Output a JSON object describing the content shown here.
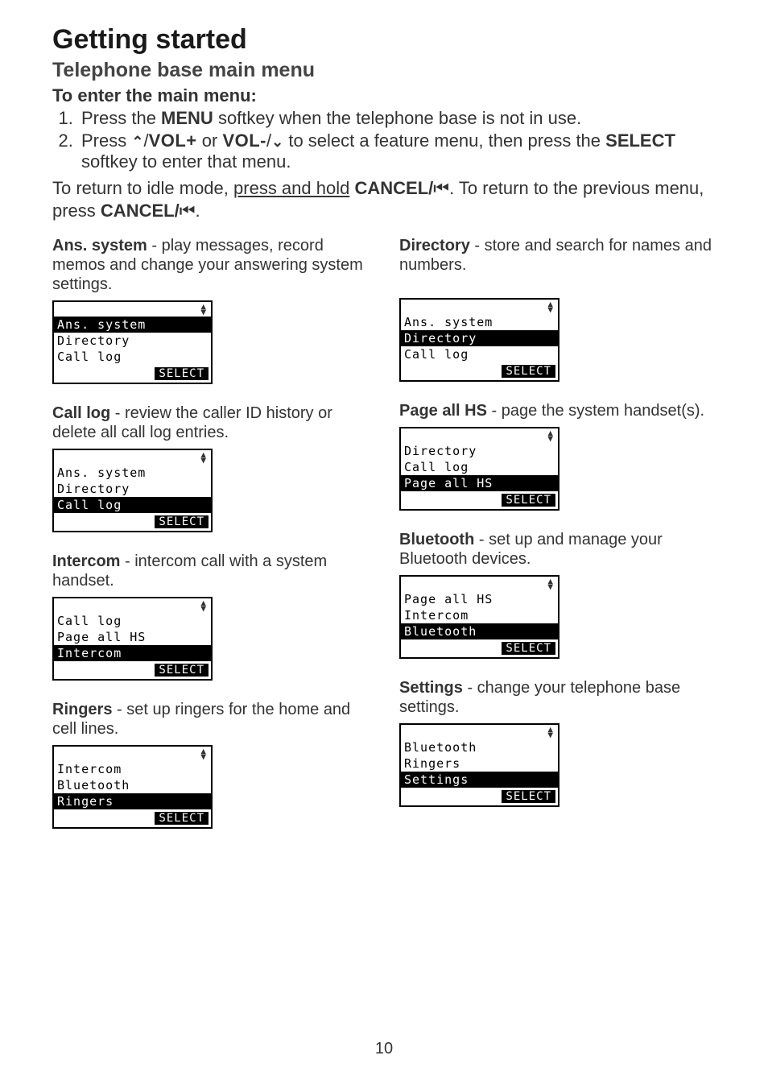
{
  "page": {
    "number": "10",
    "h1": "Getting started",
    "h2": "Telephone base main menu",
    "h3": "To enter the main menu:",
    "li1_a": "Press the ",
    "li1_b": "MENU",
    "li1_c": " softkey when the telephone base is not in use.",
    "li2_a": "Press ",
    "li2_up": "⌃",
    "li2_b": "/",
    "li2_volup": "VOL+",
    "li2_c": " or ",
    "li2_voldn": "VOL-",
    "li2_d": "/",
    "li2_dn": "⌄",
    "li2_e": " to select a feature menu, then press the ",
    "li2_sel": "SELECT",
    "li2_f": " softkey to enter that menu.",
    "ret_a": "To return to idle mode, ",
    "ret_b": "press and hold",
    "ret_c": " ",
    "ret_cancel": "CANCEL/",
    "ret_icon": "⏮",
    "ret_d": ". To return to the previous menu, press ",
    "ret_cancel2": "CANCEL/",
    "ret_icon2": "⏮",
    "ret_e": "."
  },
  "items": {
    "ans": {
      "title": "Ans. system",
      "desc": " - play messages, record memos and change your answering system settings."
    },
    "dir": {
      "title": "Directory",
      "desc": " - store and search for names and numbers."
    },
    "log": {
      "title": "Call log",
      "desc": " - review the caller ID history or delete all call log entries."
    },
    "page": {
      "title": "Page all HS",
      "desc": " - page the system handset(s)."
    },
    "int": {
      "title": "Intercom",
      "desc": " - intercom call with a system handset."
    },
    "bt": {
      "title": "Bluetooth",
      "desc": " - set up and manage your Bluetooth devices."
    },
    "ring": {
      "title": "Ringers",
      "desc": " - set up ringers for the home and cell lines."
    },
    "set": {
      "title": "Settings",
      "desc": " - change your telephone base settings."
    }
  },
  "lcd": {
    "softkey": "SELECT",
    "ans": {
      "r1": "Ans. system",
      "r2": "Directory",
      "r3": "Call log"
    },
    "dir": {
      "r1": "Ans. system",
      "r2": "Directory",
      "r3": "Call log"
    },
    "log": {
      "r1": "Ans. system",
      "r2": "Directory",
      "r3": "Call log"
    },
    "page": {
      "r1": "Directory",
      "r2": "Call log",
      "r3": "Page all HS"
    },
    "int": {
      "r1": "Call log",
      "r2": "Page all HS",
      "r3": "Intercom"
    },
    "bt": {
      "r1": "Page all HS",
      "r2": "Intercom",
      "r3": "Bluetooth"
    },
    "ring": {
      "r1": "Intercom",
      "r2": "Bluetooth",
      "r3": "Ringers"
    },
    "set": {
      "r1": "Bluetooth",
      "r2": "Ringers",
      "r3": "Settings"
    }
  }
}
